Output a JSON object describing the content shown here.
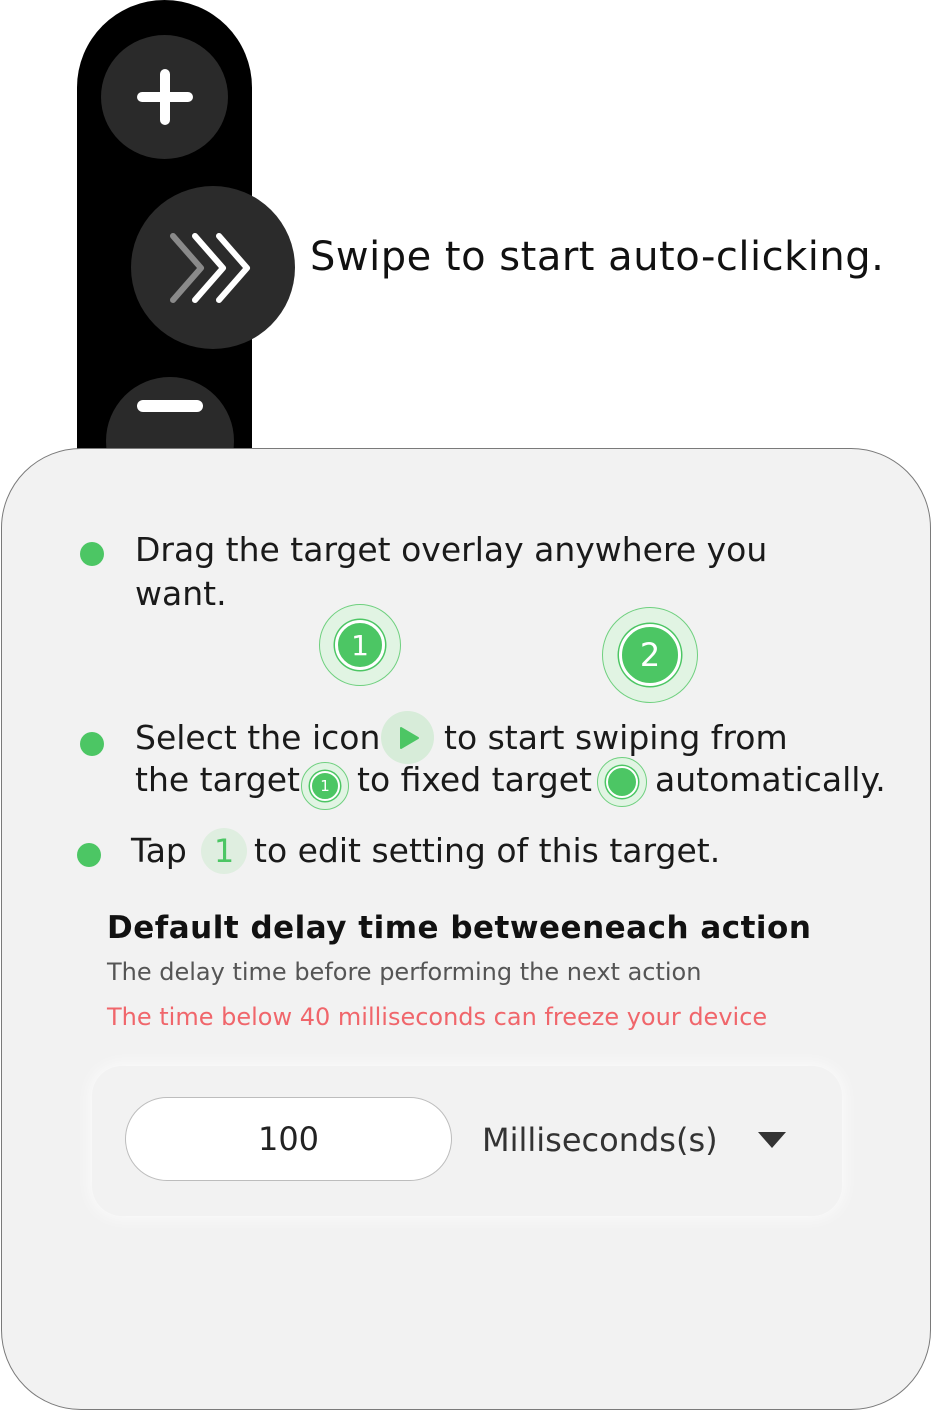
{
  "toolbar": {
    "add_icon": "plus-icon",
    "swipe_icon": "triple-chevron-right-icon",
    "remove_icon": "minus-icon",
    "swipe_hint": "Swipe to start auto-clicking."
  },
  "instructions": {
    "drag_line1": "Drag the target overlay anywhere you",
    "drag_line2": "want.",
    "target1_label": "1",
    "target2_label": "2",
    "select_part1": "Select the icon",
    "select_part2": "to start swiping from",
    "select_part3": "the target",
    "select_part4": "to fixed target",
    "select_part5": "automatically.",
    "small_target_label": "1",
    "tap_part1": "Tap",
    "tap_badge": "1",
    "tap_part2": "to edit setting of this target."
  },
  "delay": {
    "heading": "Default delay time betweeneach action",
    "description": "The delay time before performing the next action",
    "warning": "The time below 40 milliseconds can freeze your device",
    "value": "100",
    "unit": "Milliseconds(s)"
  },
  "colors": {
    "accent": "#4cc664",
    "warning": "#f0666b",
    "toolbar": "#000000",
    "card": "#f2f2f2"
  }
}
